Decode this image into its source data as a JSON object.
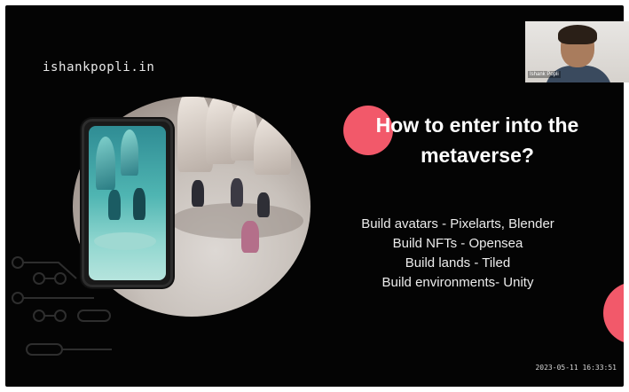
{
  "slide": {
    "brand": "ishankpopli.in",
    "title_line1": "How to enter into the",
    "title_line2": "metaverse?",
    "bullets": [
      "Build avatars - Pixelarts, Blender",
      "Build NFTs - Opensea",
      "Build lands - Tiled",
      "Build environments- Unity"
    ],
    "timestamp": "2023-05-11 16:33:51",
    "accent_color": "#f2596a",
    "background_color": "#040404"
  },
  "webcam": {
    "participant_name": "Ishank Popli"
  },
  "illustration": {
    "icons": [
      "phone-icon",
      "circuit-decoration"
    ]
  }
}
